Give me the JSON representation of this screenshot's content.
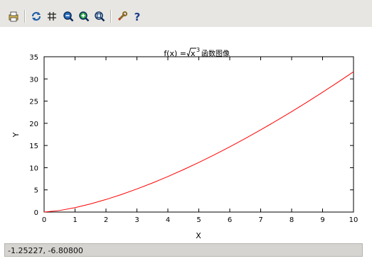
{
  "toolbar": {
    "buttons": [
      {
        "name": "print-button",
        "icon": "print-icon"
      },
      {
        "name": "refresh-button",
        "icon": "refresh-icon"
      },
      {
        "name": "grid-button",
        "icon": "grid-icon"
      },
      {
        "name": "zoom-out-button",
        "icon": "zoom-out-icon"
      },
      {
        "name": "zoom-in-button",
        "icon": "zoom-in-icon"
      },
      {
        "name": "zoom-fit-button",
        "icon": "zoom-fit-icon"
      },
      {
        "name": "settings-button",
        "icon": "wrench-icon"
      },
      {
        "name": "help-button",
        "icon": "help-icon"
      }
    ]
  },
  "chart_data": {
    "type": "line",
    "title_prefix": "f(x) = ",
    "title_radicand": "x",
    "title_exponent": "3",
    "title_suffix": "函数图像",
    "xlabel": "X",
    "ylabel": "Y",
    "xlim": [
      0,
      10
    ],
    "ylim": [
      0,
      35
    ],
    "xticks": [
      "0",
      "1",
      "2",
      "3",
      "4",
      "5",
      "6",
      "7",
      "8",
      "9",
      "10"
    ],
    "yticks": [
      "0",
      "5",
      "10",
      "15",
      "20",
      "25",
      "30",
      "35"
    ],
    "series": [
      {
        "color": "#ff0000",
        "x": [
          0,
          0.5,
          1,
          1.5,
          2,
          2.5,
          3,
          3.5,
          4,
          4.5,
          5,
          5.5,
          6,
          6.5,
          7,
          7.5,
          8,
          8.5,
          9,
          9.5,
          10
        ],
        "y": [
          0,
          0.35,
          1,
          1.84,
          2.83,
          3.95,
          5.2,
          6.55,
          8,
          9.55,
          11.18,
          12.9,
          14.7,
          16.57,
          18.52,
          20.54,
          22.63,
          24.78,
          27,
          29.28,
          31.62
        ]
      }
    ],
    "grid": false,
    "colors": {
      "axis": "#000000",
      "curve": "#ff0000"
    }
  },
  "status": {
    "coordinates": "-1.25227, -6.80800"
  }
}
